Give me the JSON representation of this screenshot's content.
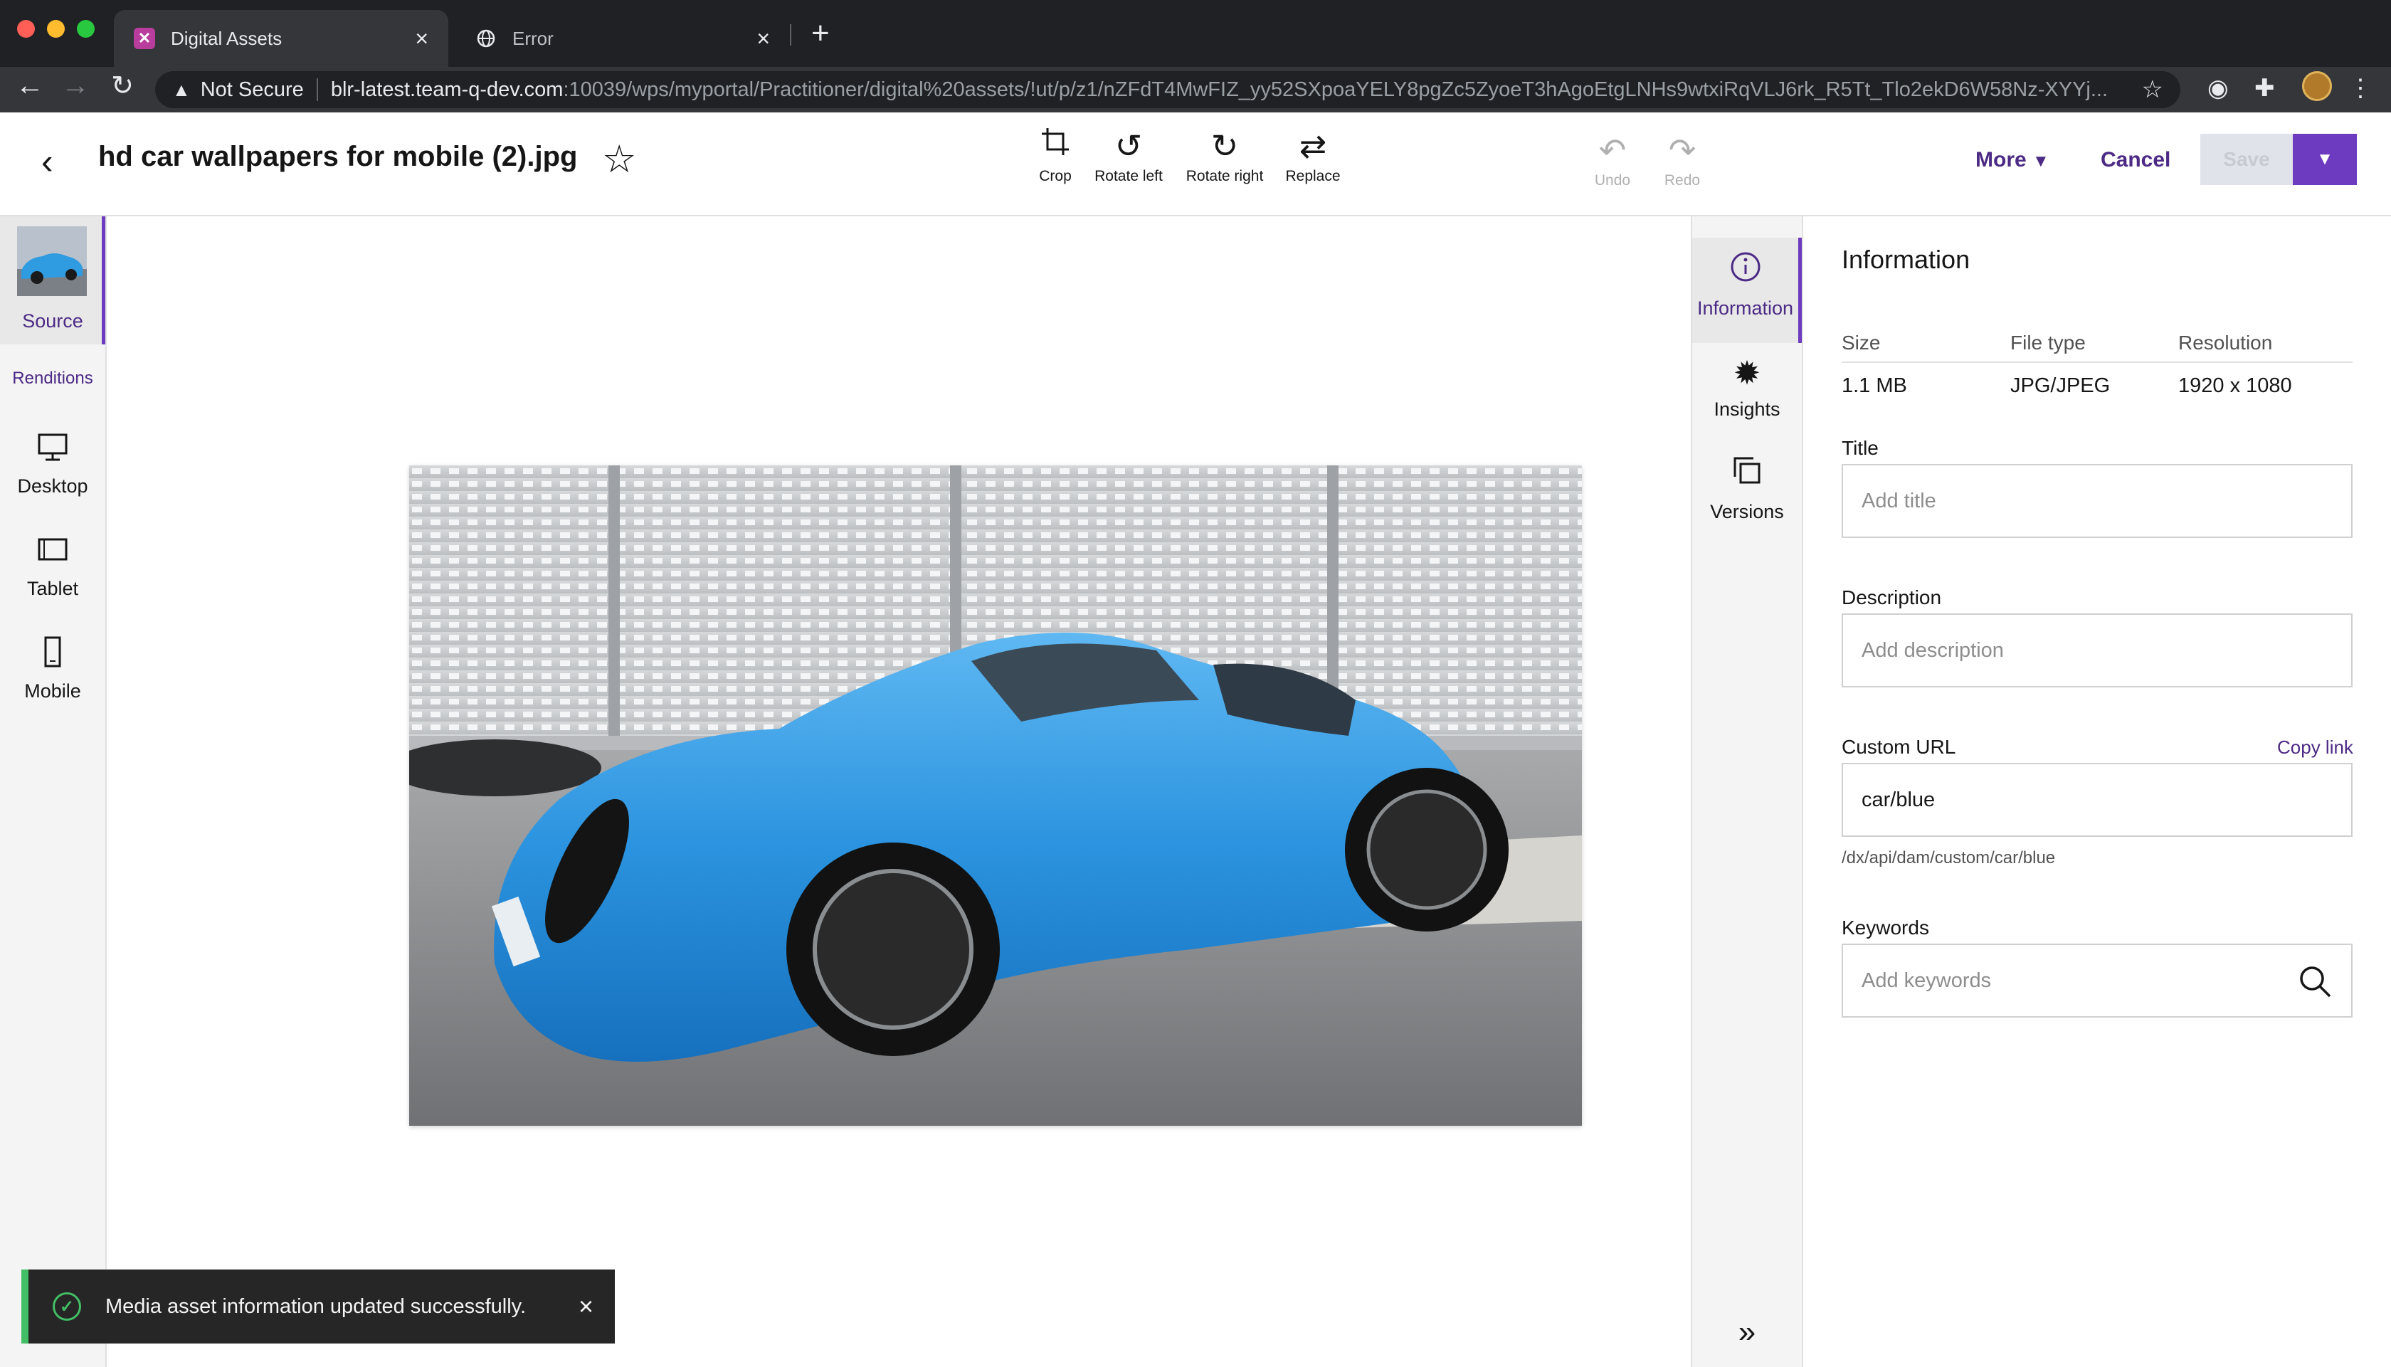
{
  "browser": {
    "tabs": [
      {
        "title": "Digital Assets",
        "active": true
      },
      {
        "title": "Error",
        "active": false
      }
    ],
    "security_label": "Not Secure",
    "url_host": "blr-latest.team-q-dev.com",
    "url_path": ":10039/wps/myportal/Practitioner/digital%20assets/!ut/p/z1/nZFdT4MwFIZ_yy52SXpoaYELY8pgZc5ZyoeT3hAgoEtgLNHs9wtxiRqVLJ6rk_R5Tt_Tlo2ekD6W58Nz-XYYj..."
  },
  "header": {
    "back_icon": "arrow-left-icon",
    "asset_title": "hd car wallpapers for mobile (2).jpg",
    "tools": {
      "crop": "Crop",
      "rotate_left": "Rotate left",
      "rotate_right": "Rotate right",
      "replace": "Replace",
      "undo": "Undo",
      "redo": "Redo"
    },
    "more_label": "More",
    "cancel_label": "Cancel",
    "save_label": "Save"
  },
  "left_rail": {
    "source_label": "Source",
    "renditions_label": "Renditions",
    "items": [
      {
        "label": "Desktop",
        "icon": "desktop-icon"
      },
      {
        "label": "Tablet",
        "icon": "tablet-icon"
      },
      {
        "label": "Mobile",
        "icon": "mobile-icon"
      }
    ]
  },
  "right_rail": {
    "items": [
      {
        "label": "Information",
        "icon": "info-icon",
        "active": true
      },
      {
        "label": "Insights",
        "icon": "insights-icon",
        "active": false
      },
      {
        "label": "Versions",
        "icon": "versions-icon",
        "active": false
      }
    ]
  },
  "panel": {
    "title": "Information",
    "meta_headers": {
      "size": "Size",
      "file_type": "File type",
      "resolution": "Resolution"
    },
    "meta_values": {
      "size": "1.1 MB",
      "file_type": "JPG/JPEG",
      "resolution": "1920 x 1080"
    },
    "title_label": "Title",
    "title_placeholder": "Add title",
    "description_label": "Description",
    "description_placeholder": "Add description",
    "custom_url_label": "Custom URL",
    "copy_link_label": "Copy link",
    "custom_url_value": "car/blue",
    "custom_url_helper": "/dx/api/dam/custom/car/blue",
    "keywords_label": "Keywords",
    "keywords_placeholder": "Add keywords"
  },
  "toast": {
    "message": "Media asset information updated successfully.",
    "status_color": "#42be65"
  },
  "colors": {
    "accent": "#6d3bbf",
    "accent_text": "#4c2a85"
  }
}
